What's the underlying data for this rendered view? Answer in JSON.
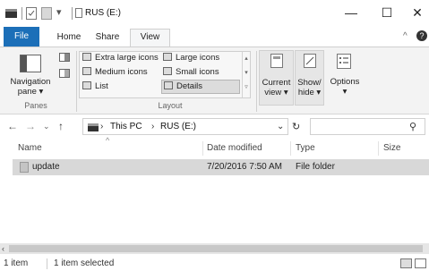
{
  "titlebar": {
    "title": "RUS (E:)",
    "minimize_glyph": "—",
    "maximize_glyph": "☐",
    "close_glyph": "✕"
  },
  "ribbon_tabs": [
    {
      "label": "File"
    },
    {
      "label": "Home"
    },
    {
      "label": "Share"
    },
    {
      "label": "View"
    }
  ],
  "ribbon": {
    "panes": {
      "navigation_pane_line1": "Navigation",
      "navigation_pane_line2": "pane ▾",
      "group_label": "Panes"
    },
    "layout": {
      "items": [
        "Extra large icons",
        "Large icons",
        "Medium icons",
        "Small icons",
        "List",
        "Details"
      ],
      "group_label": "Layout"
    },
    "current_view": {
      "line1": "Current",
      "line2": "view ▾"
    },
    "show_hide": {
      "line1": "Show/",
      "line2": "hide ▾"
    },
    "options": {
      "label": "Options",
      "arrow": "▾"
    }
  },
  "address": {
    "breadcrumb": [
      "This PC",
      "RUS (E:)"
    ],
    "separator": "›"
  },
  "columns": {
    "name": "Name",
    "date": "Date modified",
    "type": "Type",
    "size": "Size"
  },
  "files": [
    {
      "name": "update",
      "date": "7/20/2016 7:50 AM",
      "type": "File folder",
      "size": ""
    }
  ],
  "status": {
    "count": "1 item",
    "selected": "1 item selected"
  },
  "colors": {
    "file_tab": "#1c6fb8",
    "selected_row": "#d8d8d8",
    "ribbon_bg": "#f3f3f3"
  }
}
